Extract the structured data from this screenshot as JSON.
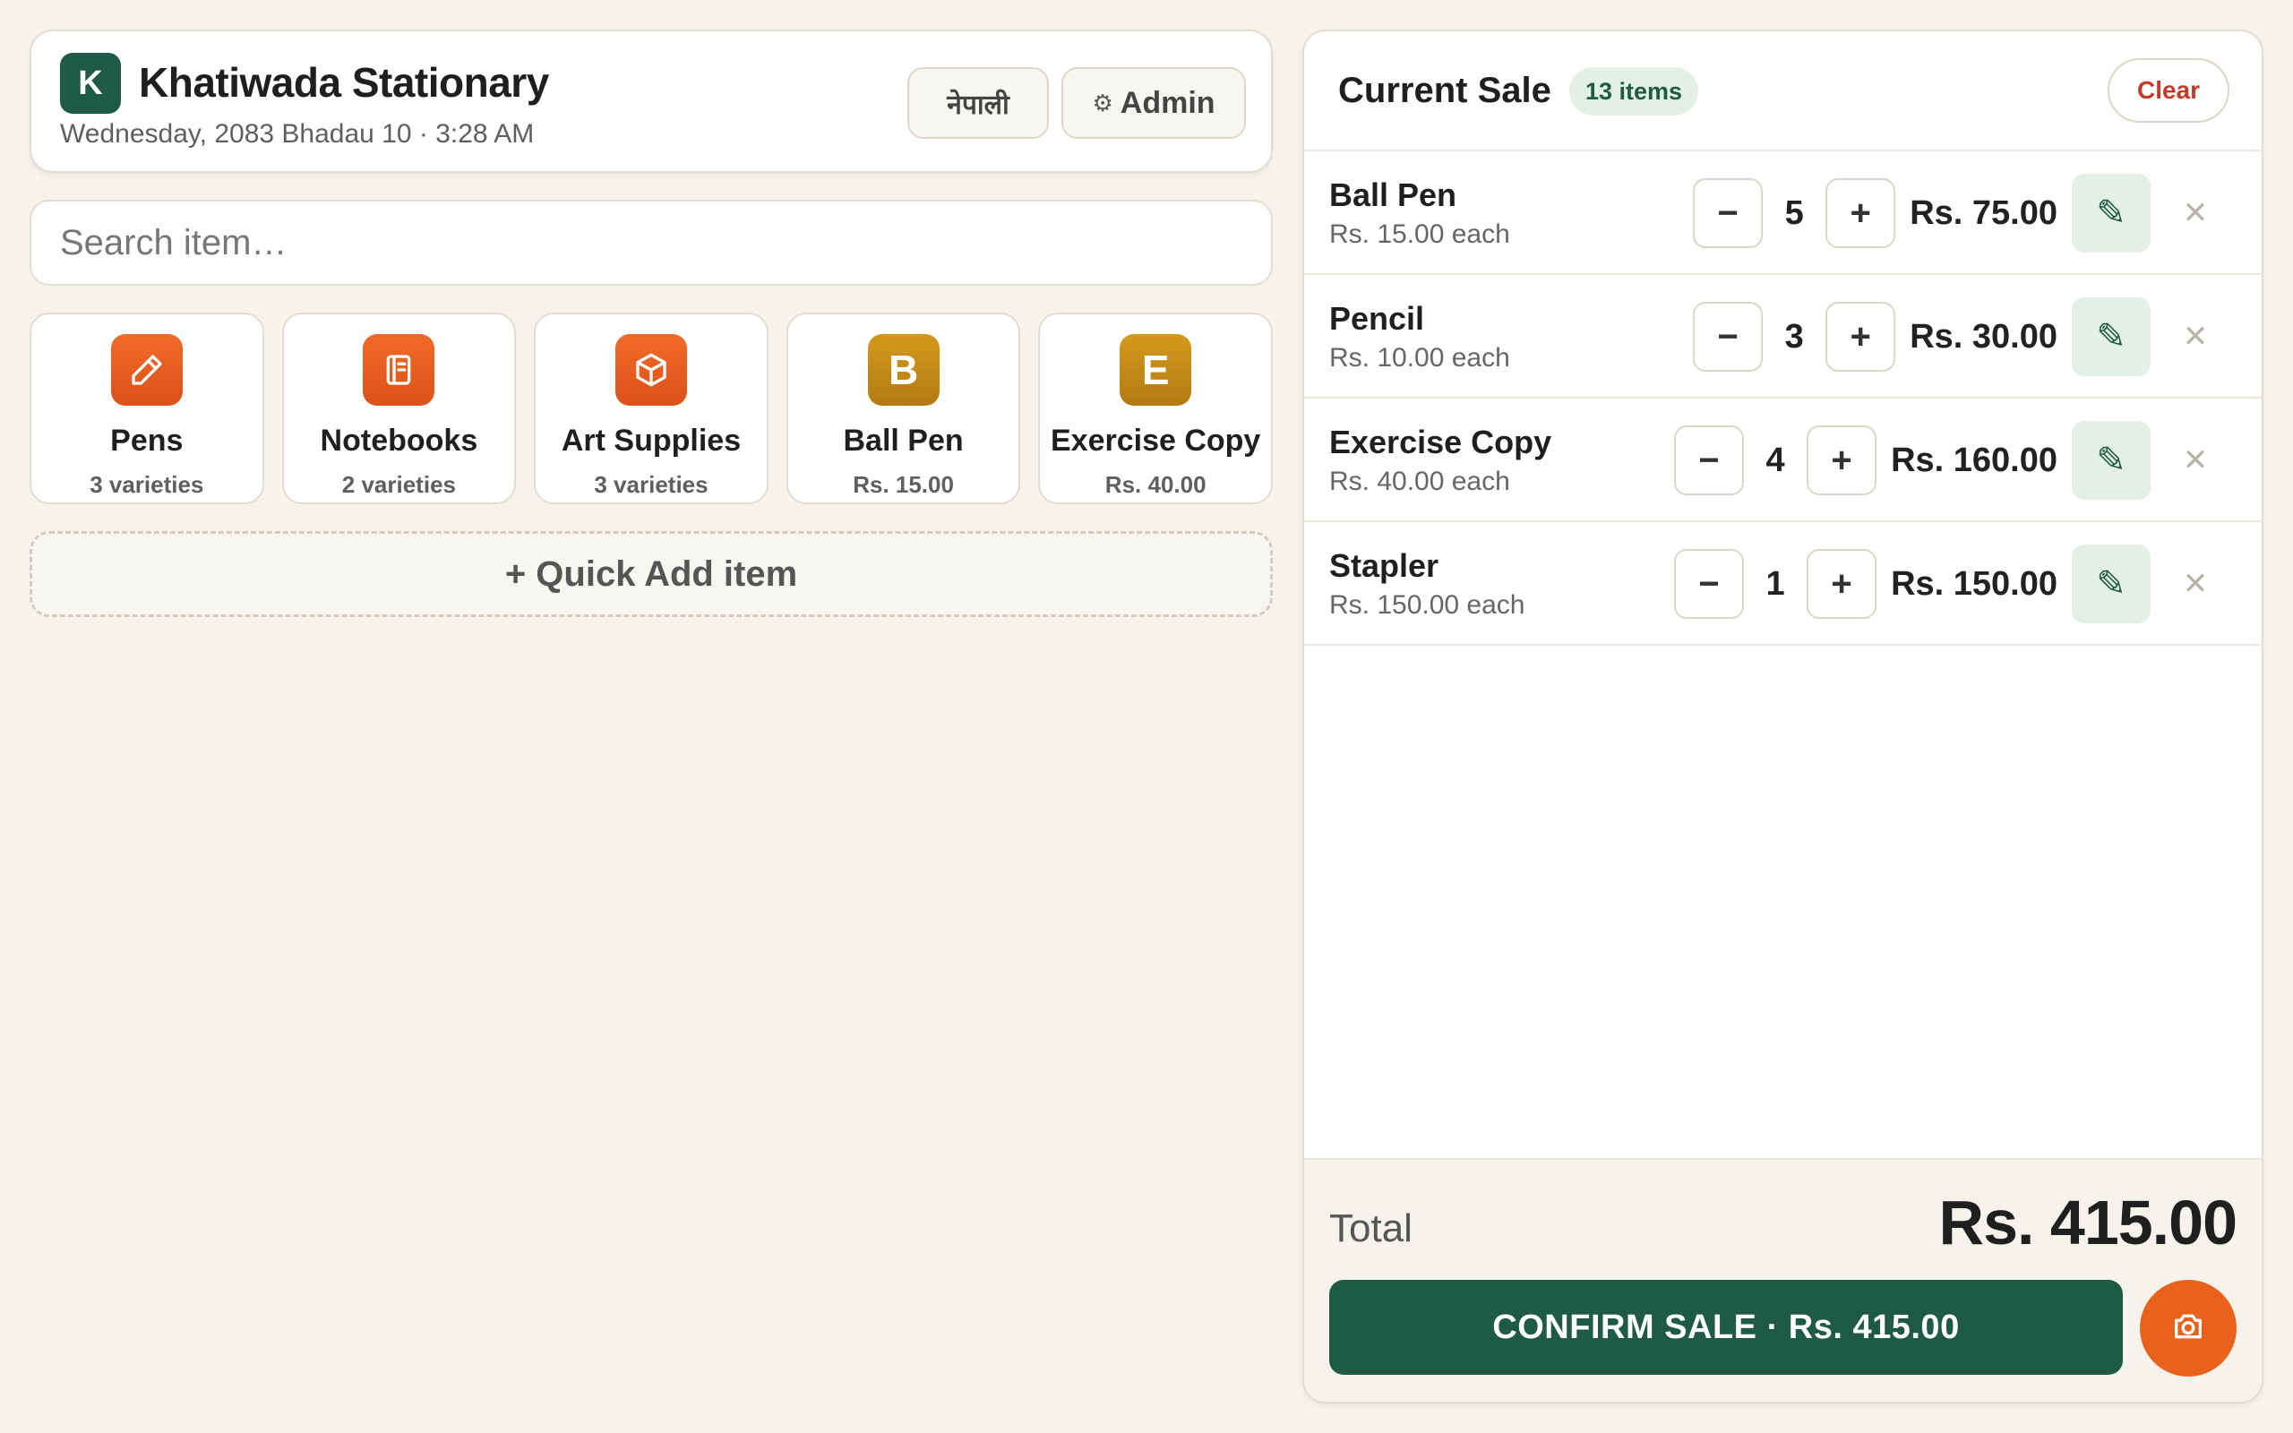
{
  "header": {
    "logo_letter": "K",
    "store_name": "Khatiwada Stationary",
    "date_time": "Wednesday, 2083 Bhadau 10 · 3:28 AM",
    "language_button": "नेपाली",
    "admin_button": "Admin"
  },
  "search": {
    "placeholder": "Search item…"
  },
  "tiles": [
    {
      "name": "Pens",
      "sub": "3 varieties",
      "icon": "pencil-icon"
    },
    {
      "name": "Notebooks",
      "sub": "2 varieties",
      "icon": "notebook-icon"
    },
    {
      "name": "Art Supplies",
      "sub": "3 varieties",
      "icon": "box-icon"
    },
    {
      "name": "Ball Pen",
      "sub": "Rs. 15.00",
      "letter": "B"
    },
    {
      "name": "Exercise Copy",
      "sub": "Rs. 40.00",
      "letter": "E"
    }
  ],
  "quick_add": "+ Quick Add item",
  "sale": {
    "title": "Current Sale",
    "count_badge": "13 items",
    "clear_button": "Clear",
    "items": [
      {
        "name": "Ball Pen",
        "price": "Rs. 15.00 each",
        "qty": "5",
        "line_total": "Rs. 75.00"
      },
      {
        "name": "Pencil",
        "price": "Rs. 10.00 each",
        "qty": "3",
        "line_total": "Rs. 30.00"
      },
      {
        "name": "Exercise Copy",
        "price": "Rs. 40.00 each",
        "qty": "4",
        "line_total": "Rs. 160.00"
      },
      {
        "name": "Stapler",
        "price": "Rs. 150.00 each",
        "qty": "1",
        "line_total": "Rs. 150.00"
      }
    ],
    "total_label": "Total",
    "total_value": "Rs. 415.00",
    "confirm_button": "CONFIRM SALE · Rs. 415.00"
  },
  "symbols": {
    "minus": "−",
    "plus": "+",
    "edit": "✎",
    "remove": "✕",
    "gear": "⚙"
  },
  "colors": {
    "brand_green": "#1f5a44",
    "accent_orange": "#e8621d",
    "tile_gold": "#c48a18",
    "clear_red": "#c43a2a"
  }
}
